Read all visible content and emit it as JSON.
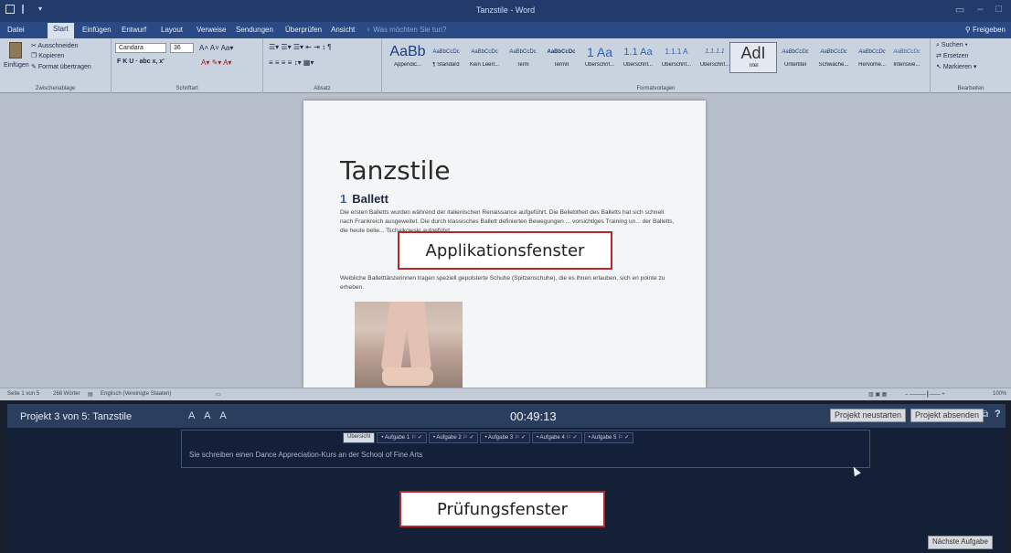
{
  "window": {
    "title": "Tanzstile - Word"
  },
  "menu_tabs": [
    "Datei",
    "Start",
    "Einfügen",
    "Entwurf",
    "Layout",
    "Verweise",
    "Sendungen",
    "Überprüfen",
    "Ansicht"
  ],
  "menu_active": "Start",
  "tell_me": "Was möchten Sie tun?",
  "share": "Freigeben",
  "ribbon": {
    "clipboard": {
      "paste": "Einfügen",
      "cut": "Ausschneiden",
      "copy": "Kopieren",
      "format_painter": "Format übertragen",
      "label": "Zwischenablage"
    },
    "font": {
      "name": "Candara",
      "size": "36",
      "row2": "F  K  U  ·  abc  x,  x'",
      "label": "Schriftart"
    },
    "paragraph": {
      "label": "Absatz"
    },
    "styles": {
      "label": "Formatvorlagen",
      "items": [
        {
          "preview": "AaBb",
          "name": "Appendic..."
        },
        {
          "preview": "AaBbCcDc",
          "name": "¶ Standard"
        },
        {
          "preview": "AaBbCcDc",
          "name": "Kein Leerr..."
        },
        {
          "preview": "AaBbCcDc",
          "name": "Term"
        },
        {
          "preview": "AaBbCcDc",
          "name": "TermII"
        },
        {
          "preview": "1  Aa",
          "name": "Überschrif..."
        },
        {
          "preview": "1.1  Aa",
          "name": "Überschrif..."
        },
        {
          "preview": "1.1.1  A",
          "name": "Überschrif..."
        },
        {
          "preview": "1.1.1.1",
          "name": "Überschrif..."
        },
        {
          "preview": "AdI",
          "name": "Titel"
        },
        {
          "preview": "AaBbCcDc",
          "name": "Untertitel"
        },
        {
          "preview": "AaBbCcDc",
          "name": "Schwache..."
        },
        {
          "preview": "AaBbCcDc",
          "name": "Hervorhe..."
        },
        {
          "preview": "AaBbCcDc",
          "name": "Intensive..."
        }
      ]
    },
    "editing": {
      "find": "Suchen",
      "replace": "Ersetzen",
      "select": "Markieren",
      "label": "Bearbeiten"
    }
  },
  "document": {
    "title": "Tanzstile",
    "heading_number": "1",
    "heading": "Ballett",
    "para1": "Die ersten Balletts wurden während der italienischen Renaissance aufgeführt. Die Beliebtheit des Balletts hat sich schnell nach Frankreich ausgeweitet. Die durch klassisches Ballett definierten Bewegungen ... vorsichtiges Training un... der Balletts, die heute belie... Tschaikowski aufgeführt...",
    "para2": "Weibliche Balletttänzerinnen tragen speziell gepolsterte Schuhe (Spitzenschuhe), die es ihnen erlauben, sich en pointe zu erheben."
  },
  "status_bar": {
    "page": "Seite 1 von 5",
    "words": "268 Wörter",
    "language": "Englisch (Vereinigte Staaten)",
    "zoom": "100%"
  },
  "exam": {
    "project": "Projekt 3 von 5: Tanzstile",
    "font_sizes": "A A A",
    "timer": "00:49:13",
    "restart": "Projekt neustarten",
    "submit": "Projekt absenden",
    "help": "?",
    "tabs": [
      "Übersicht",
      "• Aufgabe 1",
      "• Aufgabe 2",
      "• Aufgabe 3",
      "• Aufgabe 4",
      "• Aufgabe 5"
    ],
    "task_text": "Sie schreiben einen Dance Appreciation-Kurs an der School of Fine Arts",
    "next": "Nächste Aufgabe"
  },
  "annotations": {
    "app_window": "Applikationsfenster",
    "exam_window": "Prüfungsfenster"
  },
  "colors": {
    "accent": "#2b579a",
    "annotation_border": "#b4272b",
    "exam_bg": "#132036"
  }
}
